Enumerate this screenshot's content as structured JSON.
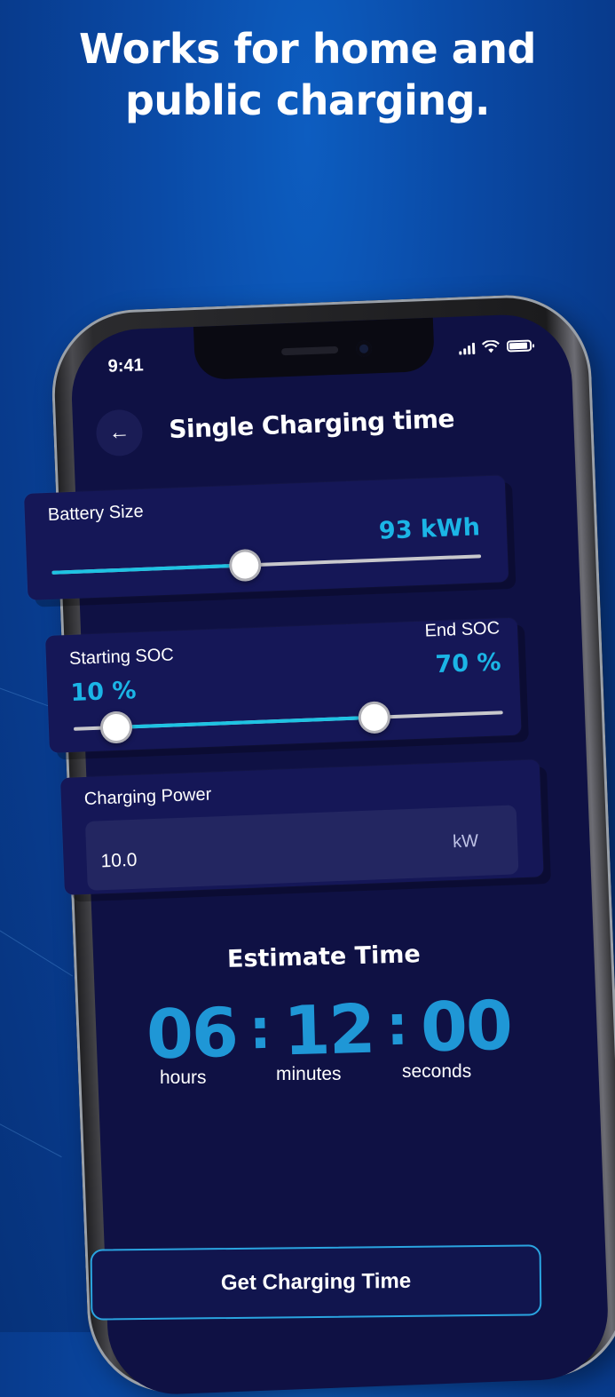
{
  "headline": {
    "line1": "Works for home and",
    "line2": "public charging."
  },
  "status_bar": {
    "time": "9:41"
  },
  "screen": {
    "title": "Single Charging time"
  },
  "battery_size": {
    "label": "Battery Size",
    "value": "93 kWh",
    "slider_fraction": 0.45
  },
  "soc": {
    "start_label": "Starting SOC",
    "start_value": "10 %",
    "end_label": "End SOC",
    "end_value": "70 %",
    "start_fraction": 0.1,
    "end_fraction": 0.7
  },
  "charging_power": {
    "label": "Charging Power",
    "value": "10.0",
    "unit": "kW"
  },
  "estimate": {
    "title": "Estimate Time",
    "hours": "06",
    "minutes": "12",
    "seconds": "00",
    "hours_label": "hours",
    "minutes_label": "minutes",
    "seconds_label": "seconds"
  },
  "cta": {
    "label": "Get Charging Time"
  },
  "colors": {
    "background": "#0a4aa6",
    "screen": "#0f1144",
    "card": "#151757",
    "accent": "#1ec3e3",
    "timer": "#1f97d6"
  }
}
